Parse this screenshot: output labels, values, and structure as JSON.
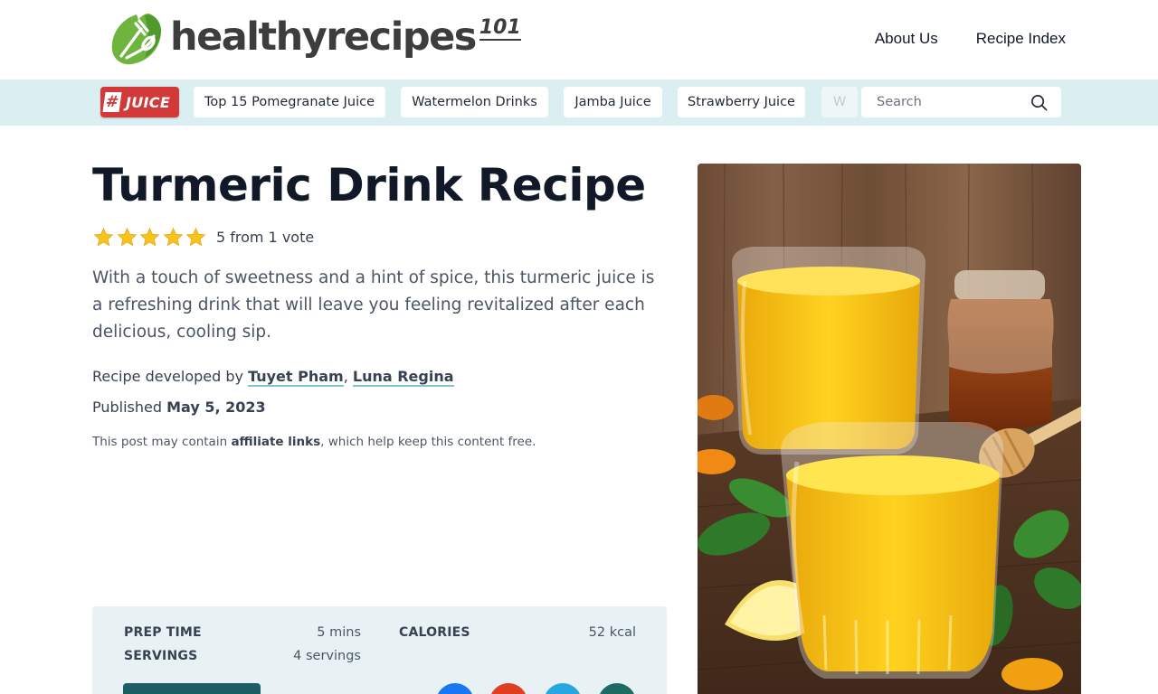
{
  "header": {
    "logo_text": "healthyrecipes",
    "logo_sup": "101",
    "nav": [
      "About Us",
      "Recipe Index"
    ]
  },
  "tagbar": {
    "badge_hash": "#",
    "badge_word": "JUICE",
    "chips": [
      "Top 15 Pomegranate Juice",
      "Watermelon Drinks",
      "Jamba Juice",
      "Strawberry Juice",
      "W"
    ],
    "search_placeholder": "Search"
  },
  "article": {
    "title": "Turmeric Drink Recipe",
    "rating_text": "5 from 1 vote",
    "rating_value": 5,
    "description": "With a touch of sweetness and a hint of spice, this turmeric juice is a refreshing drink that will leave you feeling revitalized after each delicious, cooling sip.",
    "byline_prefix": "Recipe developed by ",
    "authors": [
      "Tuyet Pham",
      "Luna Regina"
    ],
    "byline_sep": ", ",
    "published_label": "Published ",
    "published_date": "May 5, 2023",
    "affiliate_prefix": "This post may contain ",
    "affiliate_link": "affiliate links",
    "affiliate_suffix": ", which help keep this content free."
  },
  "recipe_card": {
    "prep_time_label": "PREP TIME",
    "prep_time_value": "5 mins",
    "servings_label": "SERVINGS",
    "servings_value": "4 servings",
    "calories_label": "CALORIES",
    "calories_value": "52 kcal"
  },
  "colors": {
    "tagbar_bg": "#dbeef2",
    "badge_red": "#d23a3a",
    "logo_green": "#6fb43f",
    "card_bg": "#e8f2f4",
    "button_teal": "#1d5e66",
    "social": [
      "#1877f2",
      "#e0401f",
      "#27a6e1",
      "#1d6b63"
    ]
  },
  "icons": {
    "search": "search-icon",
    "star": "star-icon",
    "logo": "leaf-fork-logo-icon"
  }
}
